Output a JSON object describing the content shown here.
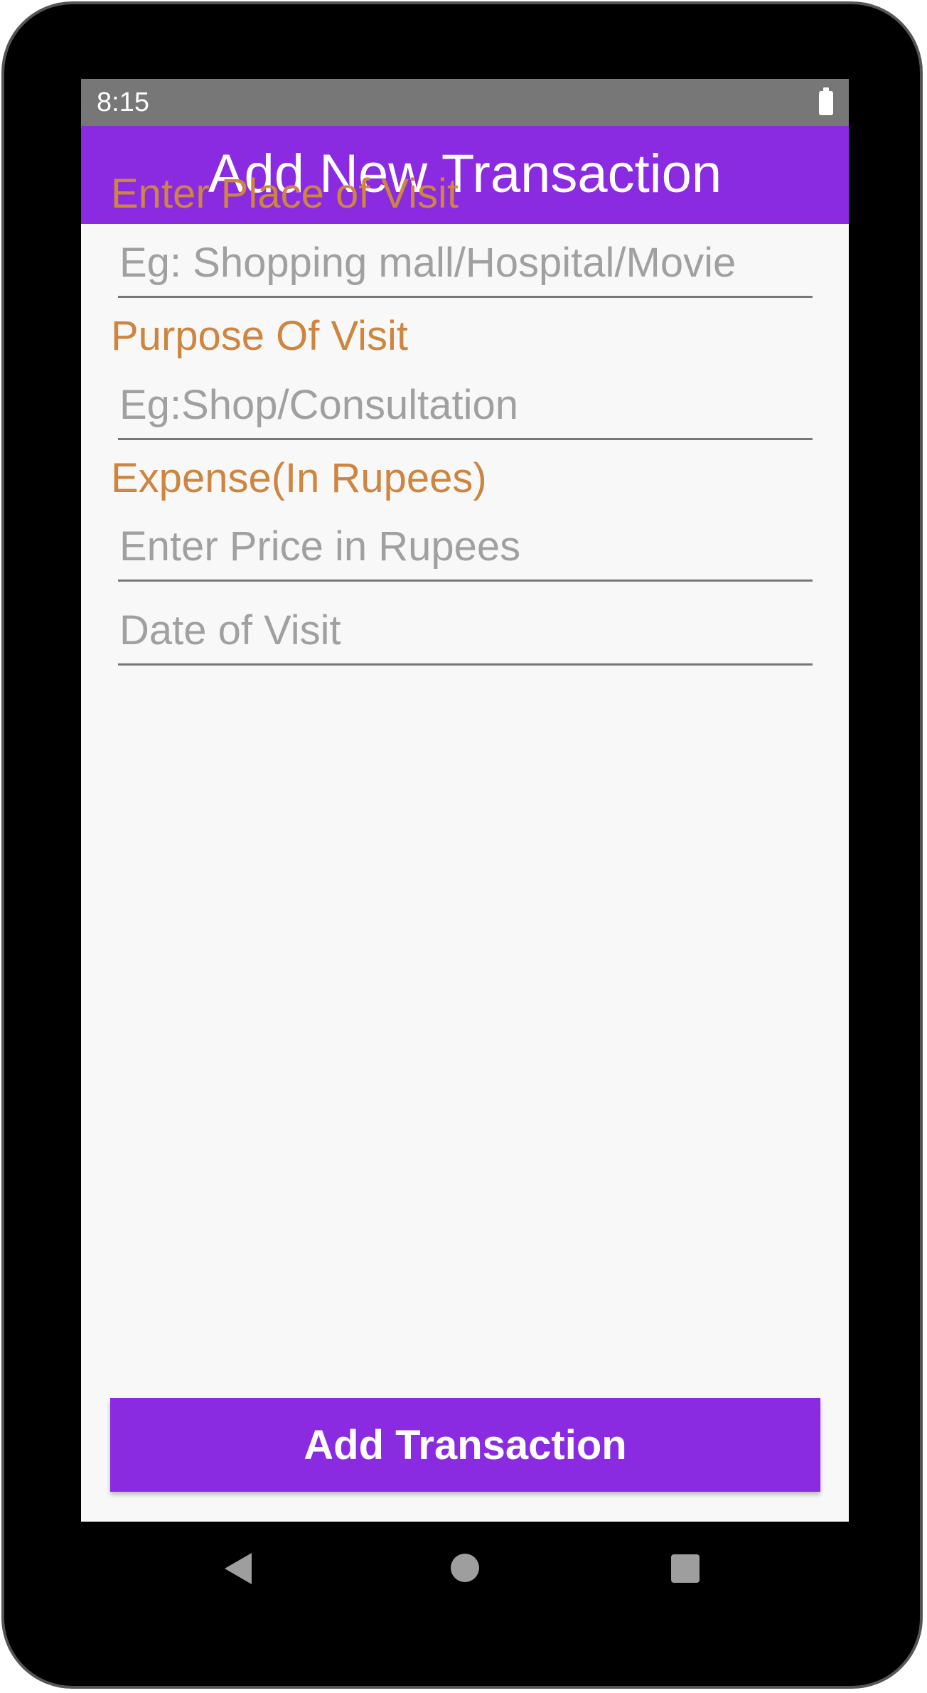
{
  "status_bar": {
    "time": "8:15",
    "battery_icon": "battery-full-icon"
  },
  "app_bar": {
    "title": "Add New Transaction",
    "color": "#8a2be2"
  },
  "form": {
    "place_label": "Enter Place of Visit",
    "place_placeholder": "Eg: Shopping mall/Hospital/Movie",
    "place_value": "",
    "purpose_label": "Purpose Of Visit",
    "purpose_placeholder": "Eg:Shop/Consultation",
    "purpose_value": "",
    "expense_label": "Expense(In Rupees)",
    "expense_placeholder": "Enter Price in Rupees",
    "expense_value": "",
    "date_placeholder": "Date of Visit",
    "date_value": "",
    "label_color": "#cd853f"
  },
  "actions": {
    "add_label": "Add Transaction"
  },
  "nav_bar": {
    "back_icon": "back-triangle-icon",
    "home_icon": "home-circle-icon",
    "recents_icon": "recents-square-icon"
  }
}
